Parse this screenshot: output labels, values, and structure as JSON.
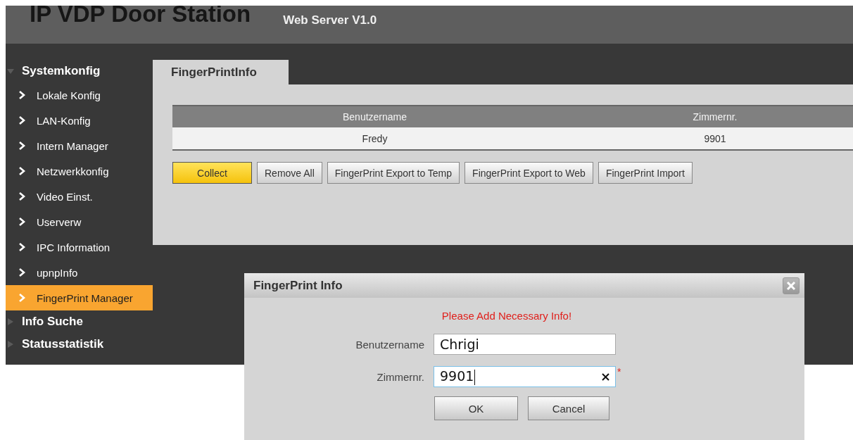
{
  "header": {
    "title": "IP VDP Door Station",
    "subtitle": "Web Server V1.0"
  },
  "sidebar": [
    {
      "label": "Systemkonfig",
      "expanded": true,
      "items": [
        {
          "label": "Lokale Konfig",
          "selected": false
        },
        {
          "label": "LAN-Konfig",
          "selected": false
        },
        {
          "label": "Intern Manager",
          "selected": false
        },
        {
          "label": "Netzwerkkonfig",
          "selected": false
        },
        {
          "label": "Video Einst.",
          "selected": false
        },
        {
          "label": "Userverw",
          "selected": false
        },
        {
          "label": "IPC Information",
          "selected": false
        },
        {
          "label": "upnpInfo",
          "selected": false
        },
        {
          "label": "FingerPrint Manager",
          "selected": true
        }
      ]
    },
    {
      "label": "Info Suche",
      "expanded": false
    },
    {
      "label": "Statusstatistik",
      "expanded": false
    }
  ],
  "tabs": [
    {
      "label": "FingerPrintInfo",
      "selected": true
    }
  ],
  "table": {
    "columns": [
      "Benutzername",
      "Zimmernr."
    ],
    "rows": [
      [
        "Fredy",
        "9901"
      ]
    ]
  },
  "buttons": [
    {
      "label": "Collect",
      "kind": "primary"
    },
    {
      "label": "Remove All",
      "kind": "normal"
    },
    {
      "label": "FingerPrint Export to Temp",
      "kind": "normal"
    },
    {
      "label": "FingerPrint Export to Web",
      "kind": "normal"
    },
    {
      "label": "FingerPrint Import",
      "kind": "normal"
    }
  ],
  "dialog": {
    "title": "FingerPrint Info",
    "message": "Please Add Necessary Info!",
    "fields": [
      {
        "label": "Benutzername",
        "value": "Chrigi",
        "focused": false
      },
      {
        "label": "Zimmernr.",
        "value": "9901",
        "focused": true,
        "required_mark": "*"
      }
    ],
    "buttons": [
      "OK",
      "Cancel"
    ]
  }
}
